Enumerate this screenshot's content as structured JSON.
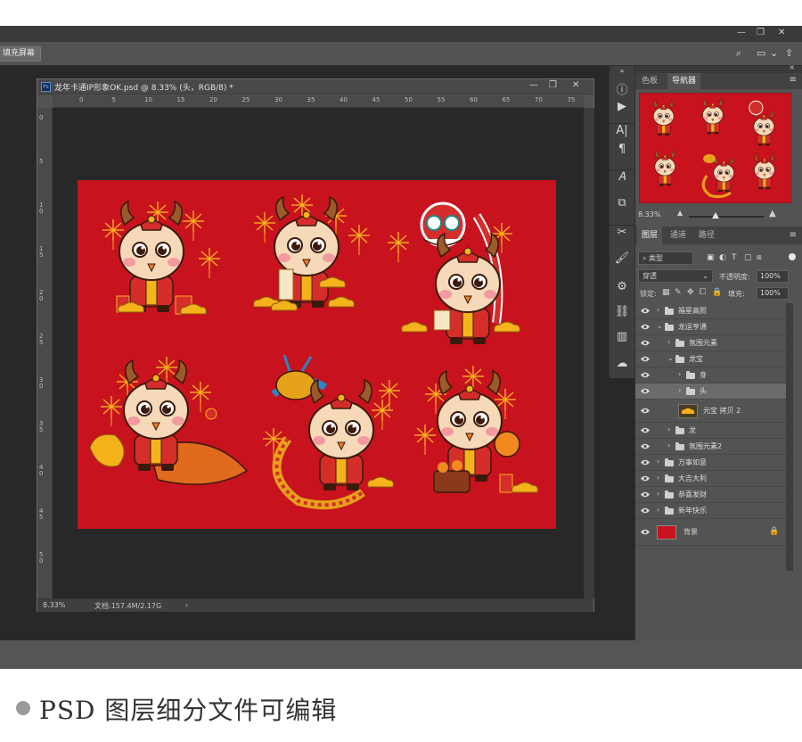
{
  "options_bar": {
    "fill_screen_button": "填充屏幕"
  },
  "document": {
    "title": "龙年卡通IP形象OK.psd @ 8.33% (头，RGB/8) *",
    "zoom": "8.33%",
    "doc_size": "文档:157.4M/2.17G",
    "ruler_ticks": [
      "0",
      "5",
      "10",
      "15",
      "20",
      "25",
      "30",
      "35",
      "40",
      "45",
      "50",
      "55",
      "60",
      "65",
      "70",
      "75"
    ],
    "ruler_v_ticks": [
      "0",
      "5",
      "1 0",
      "1 5",
      "2 0",
      "2 5",
      "3 0",
      "3 5",
      "4 0",
      "4 5",
      "5 0"
    ],
    "canvas_color": "#c8121e"
  },
  "navigator_panel": {
    "tabs": [
      "色板",
      "导航器"
    ],
    "active_tab": "导航器",
    "zoom": "8.33%"
  },
  "layers_panel": {
    "tabs": [
      "图层",
      "通道",
      "路径"
    ],
    "active_tab": "图层",
    "filter_kind": "类型",
    "blend_mode": "穿透",
    "opacity_label": "不透明度:",
    "opacity_value": "100%",
    "lock_label": "锁定:",
    "fill_label": "填充:",
    "fill_value": "100%",
    "layers": [
      {
        "name": "福星高照",
        "type": "group",
        "indent": 0,
        "expanded": false
      },
      {
        "name": "龙运亨通",
        "type": "group",
        "indent": 0,
        "expanded": true
      },
      {
        "name": "氛围元素",
        "type": "group",
        "indent": 1,
        "expanded": false
      },
      {
        "name": "龙宝",
        "type": "group",
        "indent": 1,
        "expanded": true
      },
      {
        "name": "身",
        "type": "group",
        "indent": 2,
        "expanded": false
      },
      {
        "name": "头",
        "type": "group",
        "indent": 2,
        "expanded": false,
        "selected": true
      },
      {
        "name": "元宝 拷贝 2",
        "type": "smart",
        "indent": 1
      },
      {
        "name": "龙",
        "type": "group",
        "indent": 1,
        "expanded": false
      },
      {
        "name": "氛围元素2",
        "type": "group",
        "indent": 1,
        "expanded": false
      },
      {
        "name": "万事如意",
        "type": "group",
        "indent": 0,
        "expanded": false
      },
      {
        "name": "大吉大利",
        "type": "group",
        "indent": 0,
        "expanded": false
      },
      {
        "name": "恭喜发财",
        "type": "group",
        "indent": 0,
        "expanded": false
      },
      {
        "name": "新年快乐",
        "type": "group",
        "indent": 0,
        "expanded": false
      },
      {
        "name": "背景",
        "type": "fill",
        "indent": 0,
        "locked": true
      }
    ]
  },
  "caption": "PSD 图层细分文件可编辑",
  "colors": {
    "accent_red": "#c8121e",
    "gold": "#f4b21b",
    "panel": "#535353",
    "workspace": "#282828"
  }
}
